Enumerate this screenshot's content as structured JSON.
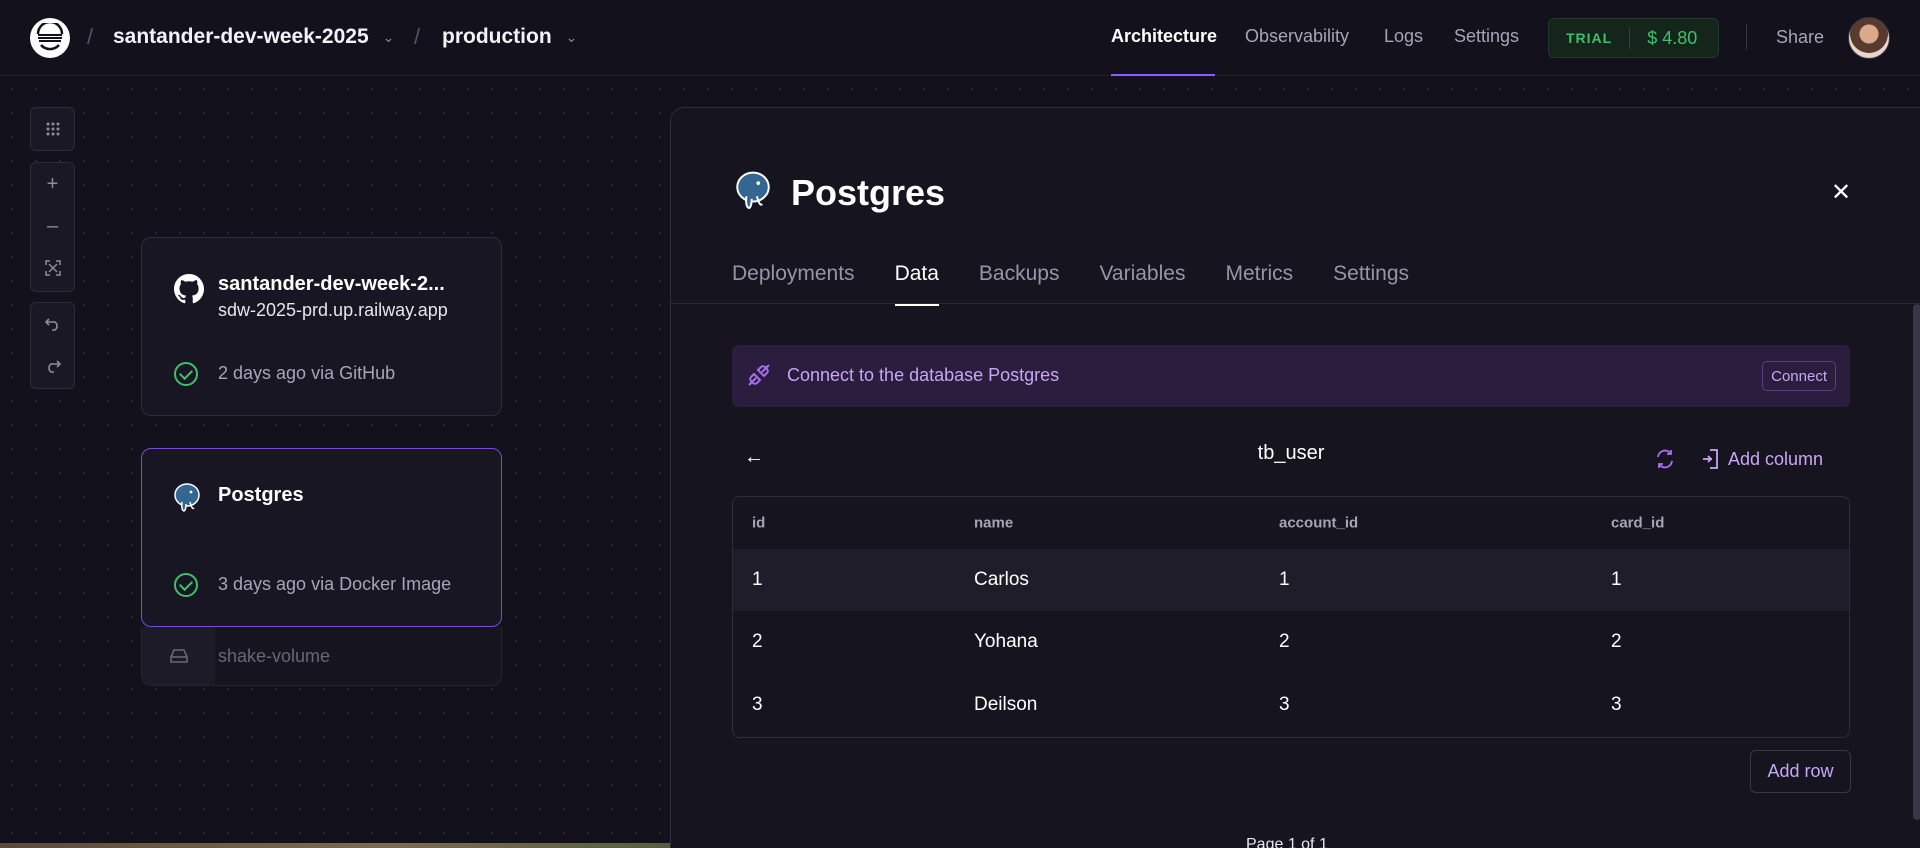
{
  "topbar": {
    "project": "santander-dev-week-2025",
    "environment": "production",
    "nav": [
      "Architecture",
      "Observability",
      "Logs",
      "Settings"
    ],
    "trial_label": "TRIAL",
    "trial_amount": "$ 4.80",
    "share": "Share",
    "separator": "/"
  },
  "services": [
    {
      "title": "santander-dev-week-2...",
      "subtitle": "sdw-2025-prd.up.railway.app",
      "status": "2 days ago via GitHub",
      "icon": "github-icon"
    },
    {
      "title": "Postgres",
      "status": "3 days ago via Docker Image",
      "icon": "postgres-elephant-icon"
    }
  ],
  "volume": {
    "label": "shake-volume",
    "icon": "hard-drive-icon"
  },
  "panel": {
    "title": "Postgres",
    "tabs": [
      "Deployments",
      "Data",
      "Backups",
      "Variables",
      "Metrics",
      "Settings"
    ],
    "active_tab": "Data",
    "connect_text": "Connect to the database Postgres",
    "connect_button": "Connect",
    "table_name": "tb_user",
    "add_column": "Add column",
    "columns": [
      "id",
      "name",
      "account_id",
      "card_id"
    ],
    "rows": [
      [
        "1",
        "Carlos",
        "1",
        "1"
      ],
      [
        "2",
        "Yohana",
        "2",
        "2"
      ],
      [
        "3",
        "Deilson",
        "3",
        "3"
      ]
    ],
    "add_row": "Add row",
    "pager": "Page 1 of 1"
  },
  "colors": {
    "accent": "#8b5cf6",
    "success": "#3fbf6a",
    "background": "#13111c"
  }
}
